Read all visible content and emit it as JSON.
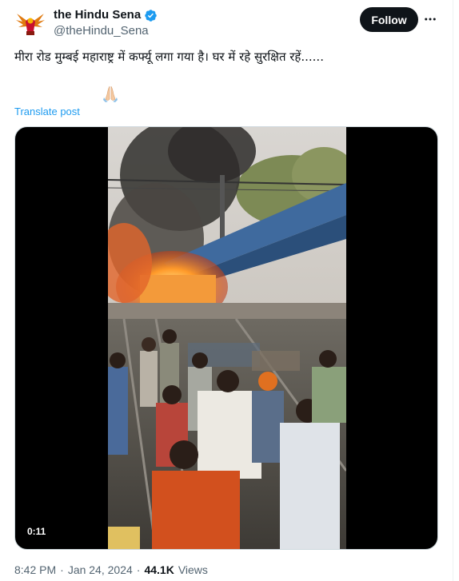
{
  "author": {
    "display_name": "the Hindu Sena",
    "handle": "@theHindu_Sena",
    "verified": true,
    "avatar_icon": "saffron-bird-emblem-icon"
  },
  "actions": {
    "follow_label": "Follow",
    "more_icon": "more-horizontal-icon"
  },
  "post": {
    "text": "मीरा रोड मुम्बई महाराष्ट्र में कर्फ्यू लगा गया है। घर में रहे सुरक्षित रहें......",
    "emoji": "folded-hands-icon",
    "translate_label": "Translate post"
  },
  "video": {
    "duration": "0:11"
  },
  "meta": {
    "time": "8:42 PM",
    "sep1": "·",
    "date": "Jan 24, 2024",
    "sep2": "·",
    "views_count": "44.1K",
    "views_label": "Views"
  },
  "colors": {
    "link": "#1d9bf0",
    "verified": "#1d9bf0",
    "muted": "#536471",
    "follow_bg": "#0f1419"
  }
}
